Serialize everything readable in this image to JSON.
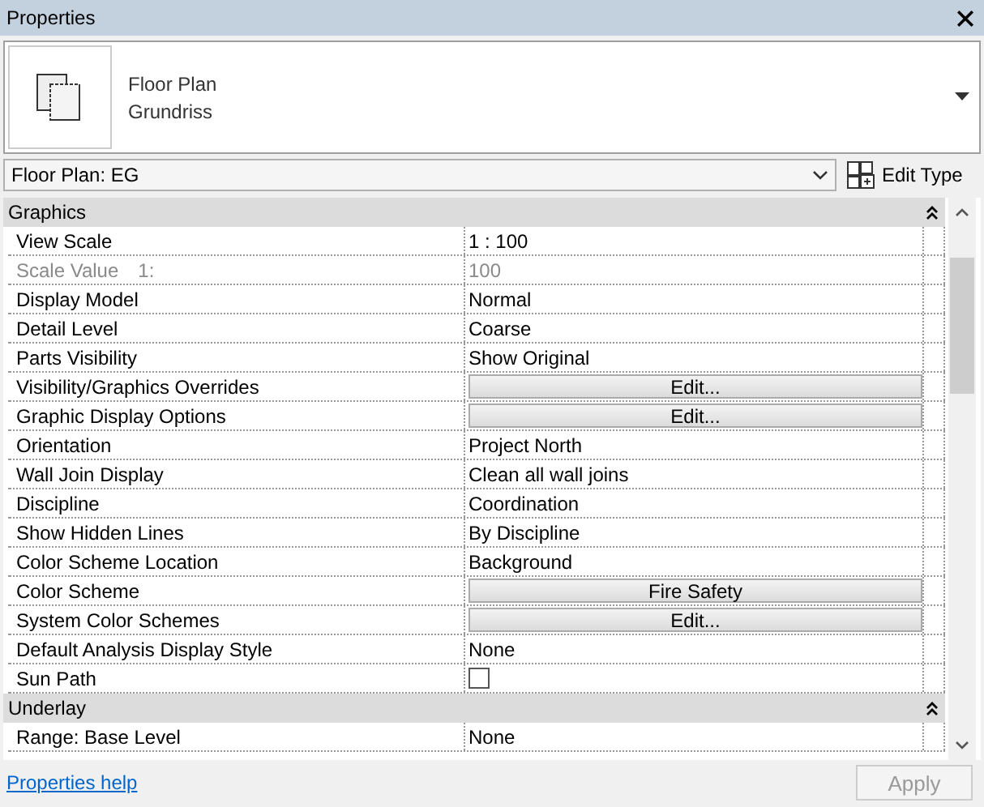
{
  "window": {
    "title": "Properties"
  },
  "type_header": {
    "family": "Floor Plan",
    "type": "Grundriss"
  },
  "instance_selector": {
    "value": "Floor Plan: EG"
  },
  "edit_type_button": {
    "label": "Edit Type"
  },
  "sections": [
    {
      "title": "Graphics",
      "expanded": true,
      "rows": [
        {
          "label": "View Scale",
          "kind": "text",
          "value": "1 : 100",
          "disabled": false
        },
        {
          "label": "Scale Value",
          "suffix": "1:",
          "kind": "text",
          "value": "100",
          "disabled": true
        },
        {
          "label": "Display Model",
          "kind": "text",
          "value": "Normal",
          "disabled": false
        },
        {
          "label": "Detail Level",
          "kind": "text",
          "value": "Coarse",
          "disabled": false
        },
        {
          "label": "Parts Visibility",
          "kind": "text",
          "value": "Show Original",
          "disabled": false
        },
        {
          "label": "Visibility/Graphics Overrides",
          "kind": "button",
          "value": "Edit...",
          "disabled": false
        },
        {
          "label": "Graphic Display Options",
          "kind": "button",
          "value": "Edit...",
          "disabled": false
        },
        {
          "label": "Orientation",
          "kind": "text",
          "value": "Project North",
          "disabled": false
        },
        {
          "label": "Wall Join Display",
          "kind": "text",
          "value": "Clean all wall joins",
          "disabled": false
        },
        {
          "label": "Discipline",
          "kind": "text",
          "value": "Coordination",
          "disabled": false
        },
        {
          "label": "Show Hidden Lines",
          "kind": "text",
          "value": "By Discipline",
          "disabled": false
        },
        {
          "label": "Color Scheme Location",
          "kind": "text",
          "value": "Background",
          "disabled": false
        },
        {
          "label": "Color Scheme",
          "kind": "button",
          "value": "Fire Safety",
          "disabled": false
        },
        {
          "label": "System Color Schemes",
          "kind": "button",
          "value": "Edit...",
          "disabled": false
        },
        {
          "label": "Default Analysis Display Style",
          "kind": "text",
          "value": "None",
          "disabled": false
        },
        {
          "label": "Sun Path",
          "kind": "checkbox",
          "checked": false,
          "disabled": false
        }
      ]
    },
    {
      "title": "Underlay",
      "expanded": true,
      "rows": [
        {
          "label": "Range: Base Level",
          "kind": "text",
          "value": "None",
          "disabled": false
        }
      ]
    }
  ],
  "footer": {
    "help_link": "Properties help",
    "apply_button": {
      "label": "Apply",
      "disabled": true
    }
  }
}
